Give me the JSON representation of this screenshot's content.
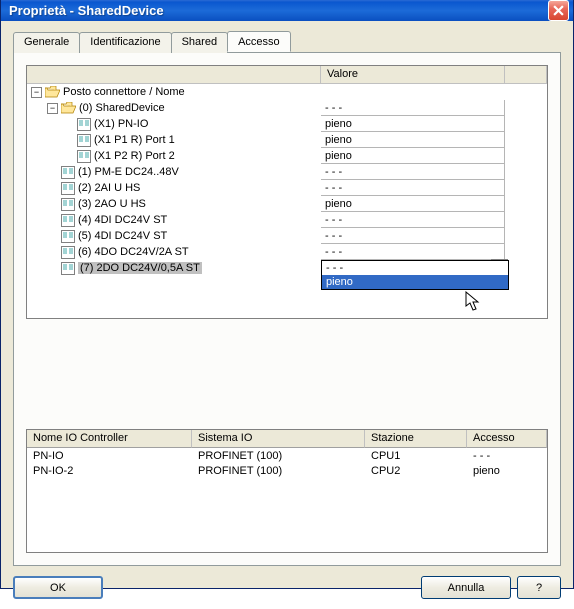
{
  "window": {
    "title": "Proprietà - SharedDevice"
  },
  "tabs": {
    "general": "Generale",
    "identification": "Identificazione",
    "shared": "Shared",
    "access": "Accesso"
  },
  "grid1": {
    "header_value": "Valore",
    "rows": [
      {
        "label": "Posto connettore / Nome",
        "value": "",
        "icon": "folder-open",
        "level": 0,
        "exp": "-",
        "has_value": false
      },
      {
        "label": "(0) SharedDevice",
        "value": "- - -",
        "icon": "folder-open",
        "level": 1,
        "exp": "-",
        "has_value": true
      },
      {
        "label": "(X1) PN-IO",
        "value": "pieno",
        "icon": "doc",
        "level": 2,
        "has_value": true
      },
      {
        "label": "(X1 P1 R) Port 1",
        "value": "pieno",
        "icon": "doc",
        "level": 2,
        "has_value": true
      },
      {
        "label": "(X1 P2 R) Port 2",
        "value": "pieno",
        "icon": "doc",
        "level": 2,
        "has_value": true
      },
      {
        "label": "(1) PM-E DC24..48V",
        "value": "- - -",
        "icon": "doc",
        "level": 1,
        "has_value": true
      },
      {
        "label": "(2) 2AI U HS",
        "value": "- - -",
        "icon": "doc",
        "level": 1,
        "has_value": true
      },
      {
        "label": "(3) 2AO U HS",
        "value": "pieno",
        "icon": "doc",
        "level": 1,
        "has_value": true
      },
      {
        "label": "(4) 4DI DC24V ST",
        "value": "- - -",
        "icon": "doc",
        "level": 1,
        "has_value": true
      },
      {
        "label": "(5) 4DI DC24V ST",
        "value": "- - -",
        "icon": "doc",
        "level": 1,
        "has_value": true
      },
      {
        "label": "(6) 4DO DC24V/2A ST",
        "value": "- - -",
        "icon": "doc",
        "level": 1,
        "has_value": true
      },
      {
        "label": "(7) 2DO DC24V/0,5A ST",
        "value": "- - -",
        "icon": "doc",
        "level": 1,
        "has_value": true,
        "selected": true,
        "combo": true
      }
    ],
    "dropdown": {
      "items": [
        "- - -",
        "pieno"
      ],
      "hover_index": 1
    }
  },
  "grid2": {
    "headers": {
      "c1": "Nome IO Controller",
      "c2": "Sistema IO",
      "c3": "Stazione",
      "c4": "Accesso"
    },
    "rows": [
      {
        "c1": "PN-IO",
        "c2": "PROFINET (100)",
        "c3": "CPU1",
        "c4": "- - -"
      },
      {
        "c1": "PN-IO-2",
        "c2": "PROFINET (100)",
        "c3": "CPU2",
        "c4": "pieno"
      }
    ]
  },
  "buttons": {
    "ok": "OK",
    "cancel": "Annulla",
    "help": "?"
  }
}
